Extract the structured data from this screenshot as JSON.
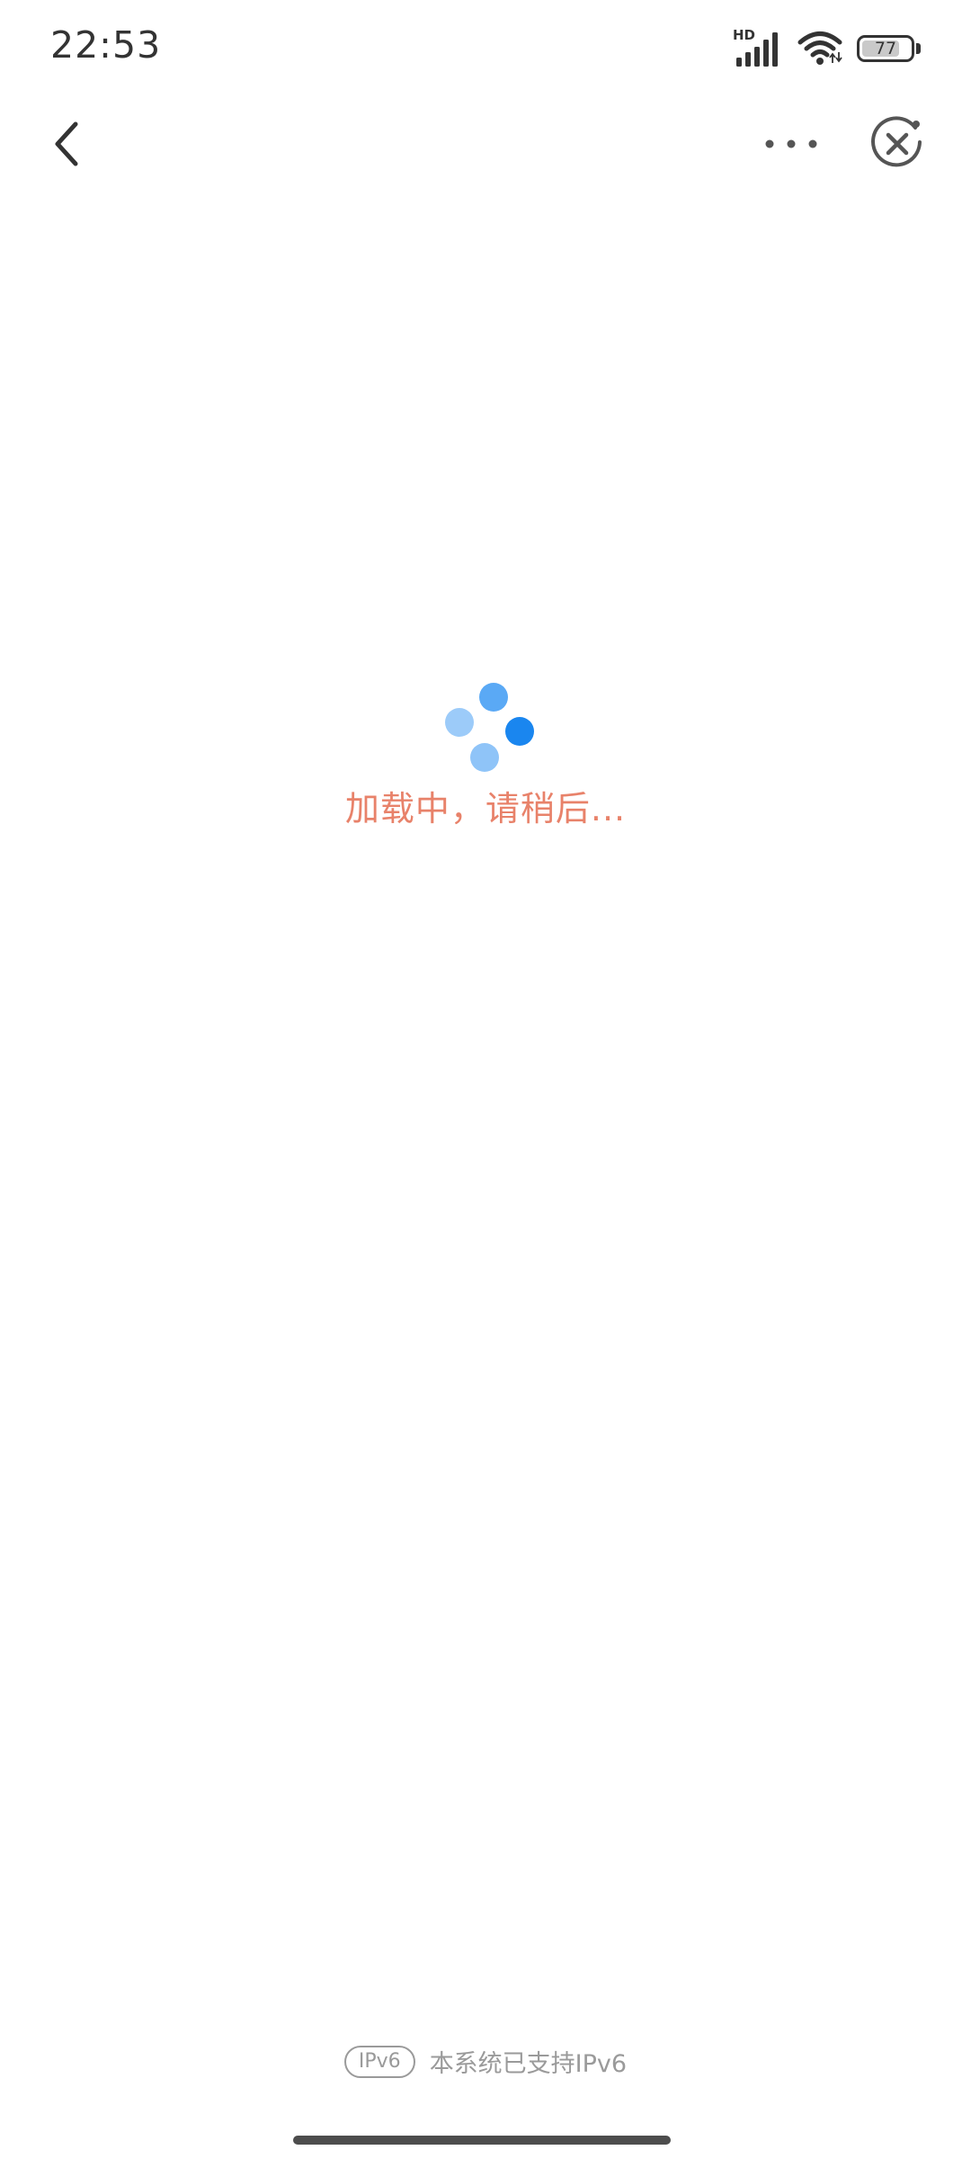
{
  "status_bar": {
    "time": "22:53",
    "network_label": "HD",
    "battery_level": "77",
    "icons": [
      "signal-icon",
      "wifi-icon",
      "battery-icon"
    ]
  },
  "nav": {
    "icons": [
      "back-arrow-icon",
      "more-dots-icon",
      "close-circle-icon"
    ]
  },
  "loading": {
    "text": "加载中，请稍后...",
    "text_color": "#e8826a",
    "spinner_colors": [
      "#5aa9f5",
      "#9ccbf9",
      "#1a86ef",
      "#8fc4f8"
    ]
  },
  "footer": {
    "badge": "IPv6",
    "text": "本系统已支持IPv6"
  }
}
